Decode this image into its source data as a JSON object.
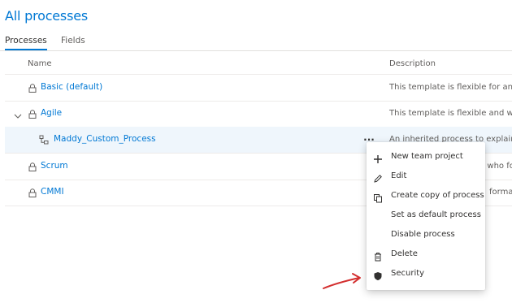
{
  "page": {
    "title": "All processes"
  },
  "tabs": [
    {
      "label": "Processes",
      "active": true
    },
    {
      "label": "Fields",
      "active": false
    }
  ],
  "table": {
    "columns": {
      "name": "Name",
      "description": "Description"
    },
    "rows": [
      {
        "name": "Basic (default)",
        "description": "This template is flexible for any p"
      },
      {
        "name": "Agile",
        "description": "This template is flexible and will",
        "expanded": true
      },
      {
        "name": "Maddy_Custom_Process",
        "description": "An inherited process to explain p",
        "child": true,
        "selected": true
      },
      {
        "name": "Scrum",
        "description": "s who fo"
      },
      {
        "name": "CMMI",
        "description": "forma"
      }
    ]
  },
  "more_button": {
    "label": "..."
  },
  "context_menu": {
    "items": [
      {
        "label": "New team project",
        "icon": "plus-icon"
      },
      {
        "label": "Edit",
        "icon": "pencil-icon"
      },
      {
        "label": "Create copy of process",
        "icon": "copy-icon"
      },
      {
        "label": "Set as default process",
        "icon": ""
      },
      {
        "label": "Disable process",
        "icon": ""
      },
      {
        "label": "Delete",
        "icon": "trash-icon"
      },
      {
        "label": "Security",
        "icon": "shield-icon"
      }
    ]
  },
  "colors": {
    "accent": "#0078d4",
    "selected_row": "#eff6fc",
    "annotation_arrow": "#d32f2f"
  }
}
